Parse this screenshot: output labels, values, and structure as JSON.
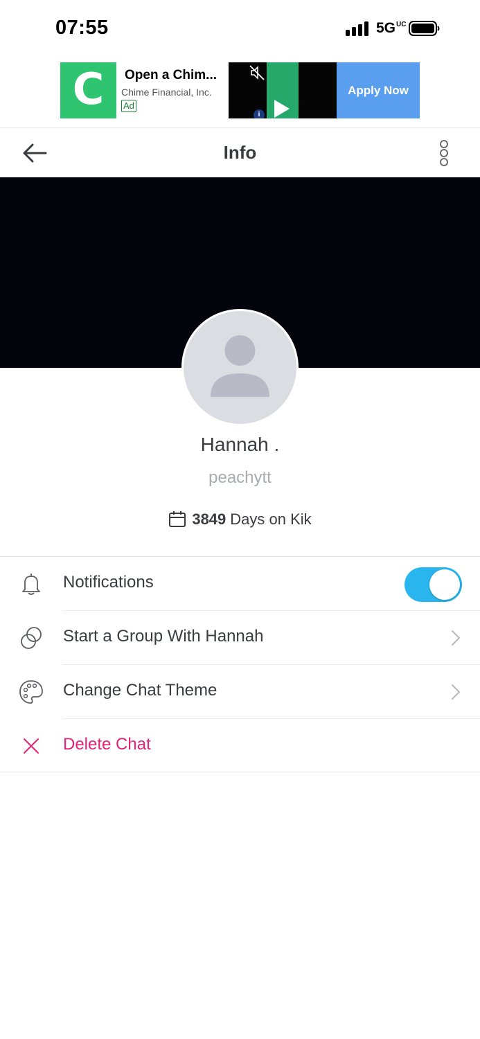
{
  "status_bar": {
    "time": "07:55",
    "network": "5G",
    "network_suffix": "UC"
  },
  "ad": {
    "logo_letter": "C",
    "title": "Open a Chim...",
    "company": "Chime Financial, Inc.",
    "badge": "Ad",
    "cta": "Apply Now",
    "colors": {
      "logo_bg": "#2fc46f",
      "cta_bg": "#5a9ef0"
    }
  },
  "header": {
    "title": "Info"
  },
  "profile": {
    "display_name": "Hannah .",
    "username": "peachytt",
    "days_count": "3849",
    "days_label": "Days on Kik"
  },
  "menu": {
    "notifications": {
      "label": "Notifications",
      "enabled": true,
      "icon": "bell-icon"
    },
    "start_group": {
      "label": "Start a Group With Hannah",
      "icon": "group-icon"
    },
    "change_theme": {
      "label": "Change Chat Theme",
      "icon": "palette-icon"
    },
    "delete_chat": {
      "label": "Delete Chat",
      "icon": "close-icon"
    }
  },
  "colors": {
    "accent_toggle": "#29b6ee",
    "delete": "#e3237a",
    "cover": "#03030b"
  }
}
